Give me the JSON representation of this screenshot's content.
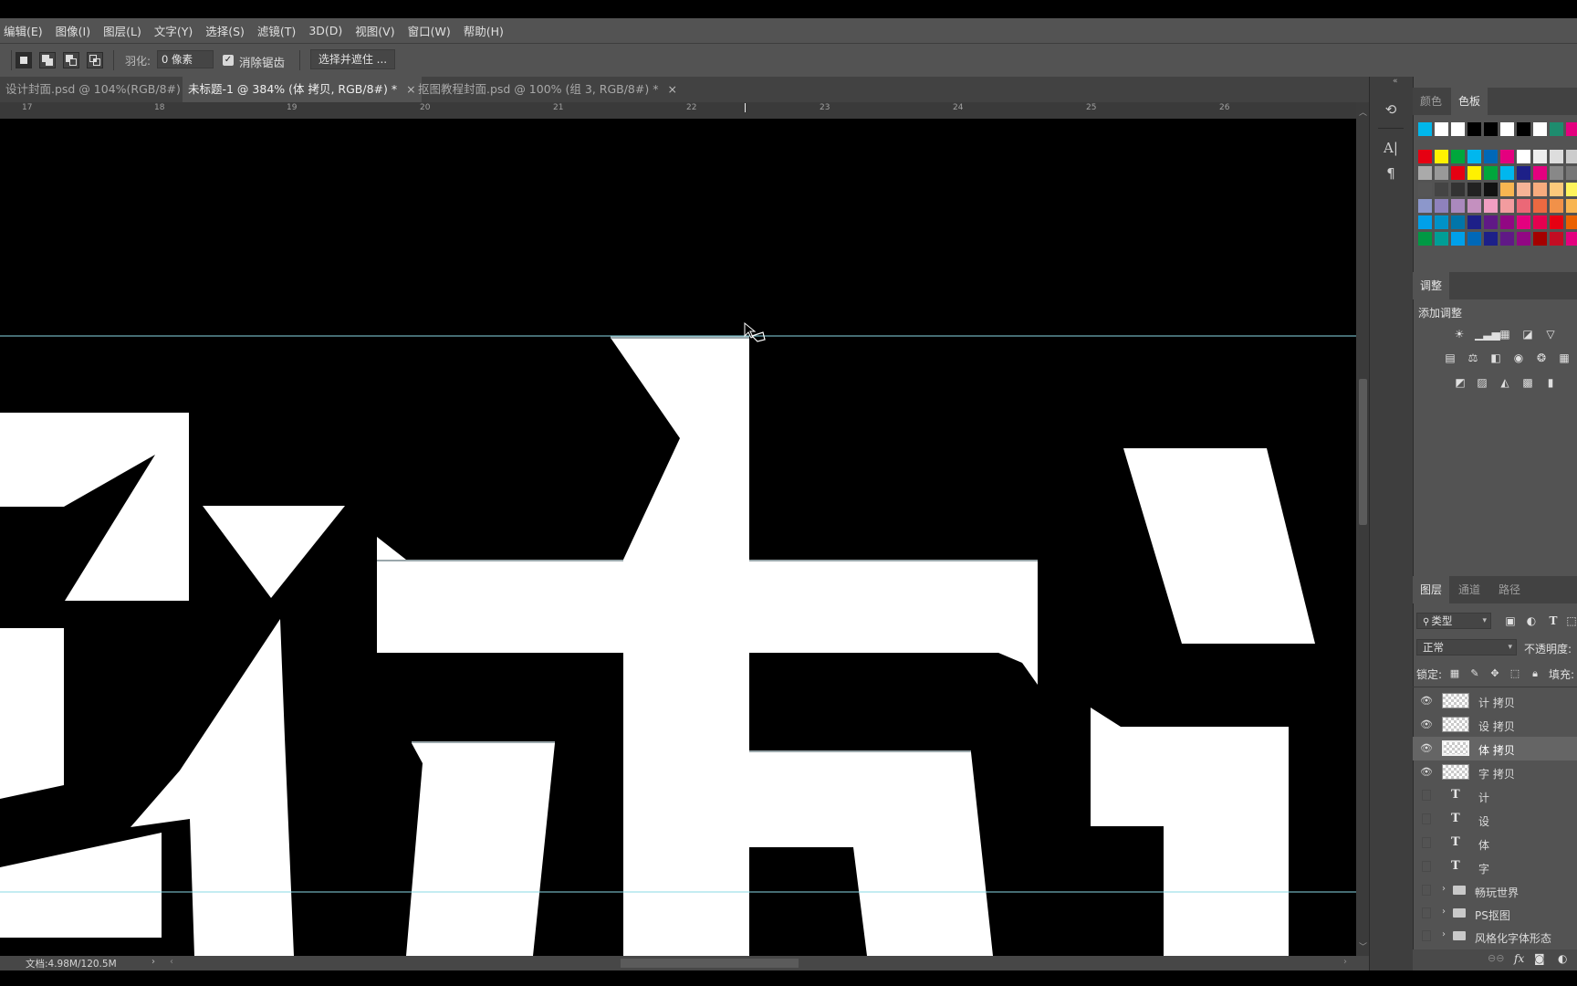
{
  "menubar": {
    "items": [
      "编辑(E)",
      "图像(I)",
      "图层(L)",
      "文字(Y)",
      "选择(S)",
      "滤镜(T)",
      "3D(D)",
      "视图(V)",
      "窗口(W)",
      "帮助(H)"
    ]
  },
  "options": {
    "feather_label": "羽化:",
    "feather_value": "0 像素",
    "antialias_label": "消除锯齿",
    "antialias_checked": true,
    "select_mask_button": "选择并遮住 ..."
  },
  "tabs": [
    {
      "label": "设计封面.psd @ 104%(RGB/8#)",
      "active": false
    },
    {
      "label": "未标题-1 @ 384% (体 拷贝, RGB/8#) *",
      "active": true
    },
    {
      "label": "抠图教程封面.psd @ 100% (组 3, RGB/8#) *",
      "active": false
    }
  ],
  "ruler": {
    "ticks": [
      "17",
      "18",
      "19",
      "20",
      "21",
      "22",
      "23",
      "24",
      "25",
      "26"
    ]
  },
  "status": {
    "doc_size": "文档:4.98M/120.5M"
  },
  "color_panel": {
    "tabs": [
      "颜色",
      "色板"
    ],
    "active_tab": "色板",
    "swatch_rows": [
      [
        "#00b7eb",
        "#ffffff",
        "#ffffff",
        "#000000",
        "#000000",
        "#ffffff",
        "#000000",
        "#ffffff",
        "#1e8c6e",
        "#e4007f",
        "#fff100"
      ],
      [
        "#e60012",
        "#fff100",
        "#00a73c",
        "#00b7ee",
        "#0068b7",
        "#e4007f",
        "#ffffff",
        "#eeeeee",
        "#dddddd",
        "#cccccc",
        "#bbbbbb"
      ],
      [
        "#aaaaaa",
        "#999999",
        "#e60012",
        "#fff100",
        "#00a73c",
        "#00b7ee",
        "#1d2088",
        "#e4007f",
        "#888888",
        "#777777",
        "#666666"
      ],
      [
        "#555555",
        "#444444",
        "#333333",
        "#222222",
        "#111111",
        "#f8b551",
        "#f5b396",
        "#f7ab7e",
        "#fcc97b",
        "#fff45c",
        "#cce198"
      ],
      [
        "#8c97cb",
        "#8f82bc",
        "#aa89bd",
        "#c490bf",
        "#f19ec2",
        "#f29c9f",
        "#eb6877",
        "#ec6941",
        "#f19149",
        "#f8b551",
        "#fff100"
      ],
      [
        "#00a0e9",
        "#0092c7",
        "#0075a9",
        "#1d2088",
        "#601986",
        "#920783",
        "#e4007f",
        "#e5004f",
        "#e60012",
        "#eb6100",
        "#f39800"
      ],
      [
        "#009944",
        "#009e96",
        "#00a0e9",
        "#0068b7",
        "#1d2088",
        "#601986",
        "#920783",
        "#a40000",
        "#c30d23",
        "#e4007f",
        "#e5004f"
      ]
    ]
  },
  "adjustments": {
    "header": "调整",
    "add_label": "添加调整"
  },
  "layers_panel": {
    "tabs": [
      "图层",
      "通道",
      "路径"
    ],
    "active_tab": "图层",
    "filter_kind": "类型",
    "blend_mode": "正常",
    "opacity_label": "不透明度:",
    "lock_label": "锁定:",
    "fill_label": "填充:",
    "layers": [
      {
        "name": "计 拷贝",
        "kind": "pixel",
        "visible": true,
        "selected": false
      },
      {
        "name": "设 拷贝",
        "kind": "pixel",
        "visible": true,
        "selected": false
      },
      {
        "name": "体 拷贝",
        "kind": "pixel",
        "visible": true,
        "selected": true
      },
      {
        "name": "字 拷贝",
        "kind": "pixel",
        "visible": true,
        "selected": false
      },
      {
        "name": "计",
        "kind": "text",
        "visible": false,
        "selected": false
      },
      {
        "name": "设",
        "kind": "text",
        "visible": false,
        "selected": false
      },
      {
        "name": "体",
        "kind": "text",
        "visible": false,
        "selected": false
      },
      {
        "name": "字",
        "kind": "text",
        "visible": false,
        "selected": false
      },
      {
        "name": "畅玩世界",
        "kind": "group",
        "visible": false,
        "selected": false
      },
      {
        "name": "PS抠图",
        "kind": "group",
        "visible": false,
        "selected": false
      },
      {
        "name": "风格化字体形态",
        "kind": "group",
        "visible": false,
        "selected": false
      }
    ],
    "footer_fx": "fx"
  }
}
